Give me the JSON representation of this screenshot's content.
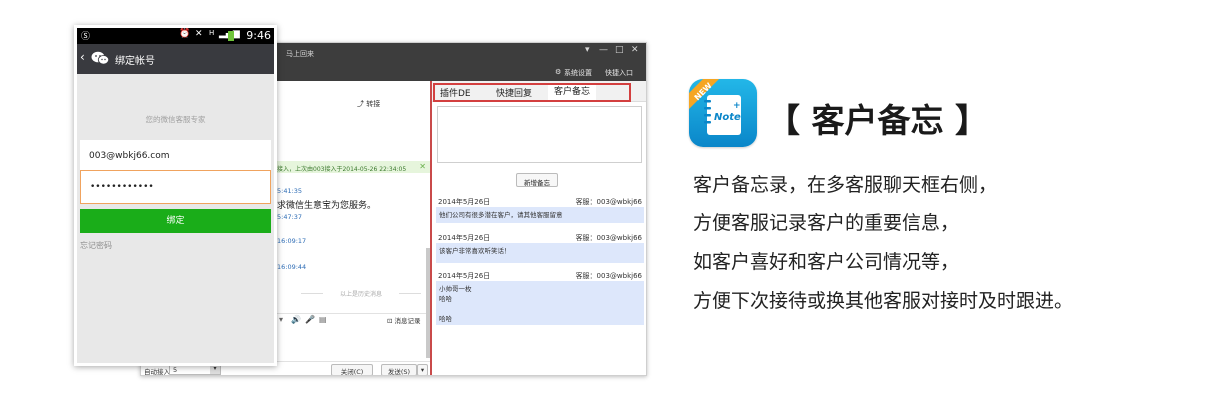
{
  "desktop": {
    "title": "马上回来",
    "window_controls": [
      "▾",
      "—",
      "□",
      "✕"
    ],
    "toolbar": {
      "system_settings": "系统设置",
      "quick_entry": "快捷入口"
    },
    "chat": {
      "transfer_label": "转接",
      "notice": "接入，上次由003接入于2014-05-26 22:34:05",
      "lines": [
        {
          "text": "5:41:35",
          "kind": "time"
        },
        {
          "text": "求微信生意宝为您服务。",
          "kind": "msg"
        },
        {
          "text": "5:47:37",
          "kind": "time"
        },
        {
          "text": "16:09:17",
          "kind": "time"
        },
        {
          "text": "16:09:44",
          "kind": "time"
        }
      ],
      "history_separator": "以上是历史消息",
      "message_record": "消息记录",
      "auto_accept_label": "自动接入",
      "auto_accept_value": "5",
      "close_button": "关闭(C)",
      "send_button": "发送(S)"
    },
    "memo_panel": {
      "tabs": [
        "插件DE",
        "快捷回复",
        "客户备忘"
      ],
      "active_tab": 2,
      "add_button": "新增备忘",
      "entries": [
        {
          "date": "2014年5月26日",
          "agent": "客服：003@wbkj66",
          "lines": [
            "他们公司有很多潜在客户，请其他客服留意"
          ]
        },
        {
          "date": "2014年5月26日",
          "agent": "客服：003@wbkj66",
          "lines": [
            "该客户非常喜欢听笑话！"
          ]
        },
        {
          "date": "2014年5月26日",
          "agent": "客服：003@wbkj66",
          "lines": [
            "小帅哥一枚",
            "哈哈",
            "",
            "哈哈"
          ]
        }
      ],
      "highlight_color": "#d33f3f"
    }
  },
  "phone": {
    "status_time": "9:46",
    "header_title": "绑定帐号",
    "tagline": "您的微信客服专家",
    "account_value": "003@wbkj66.com",
    "password_mask": "••••••••••••",
    "bind_button": "绑定",
    "forgot_password": "忘记密码",
    "accent_color": "#1aad19"
  },
  "feature": {
    "icon_badge": "NEW",
    "icon_text": "Note",
    "title": "【 客户备忘 】",
    "description": [
      "客户备忘录，在多客服聊天框右侧，",
      "方便客服记录客户的重要信息，",
      "如客户喜好和客户公司情况等，",
      "方便下次接待或换其他客服对接时及时跟进。"
    ]
  }
}
